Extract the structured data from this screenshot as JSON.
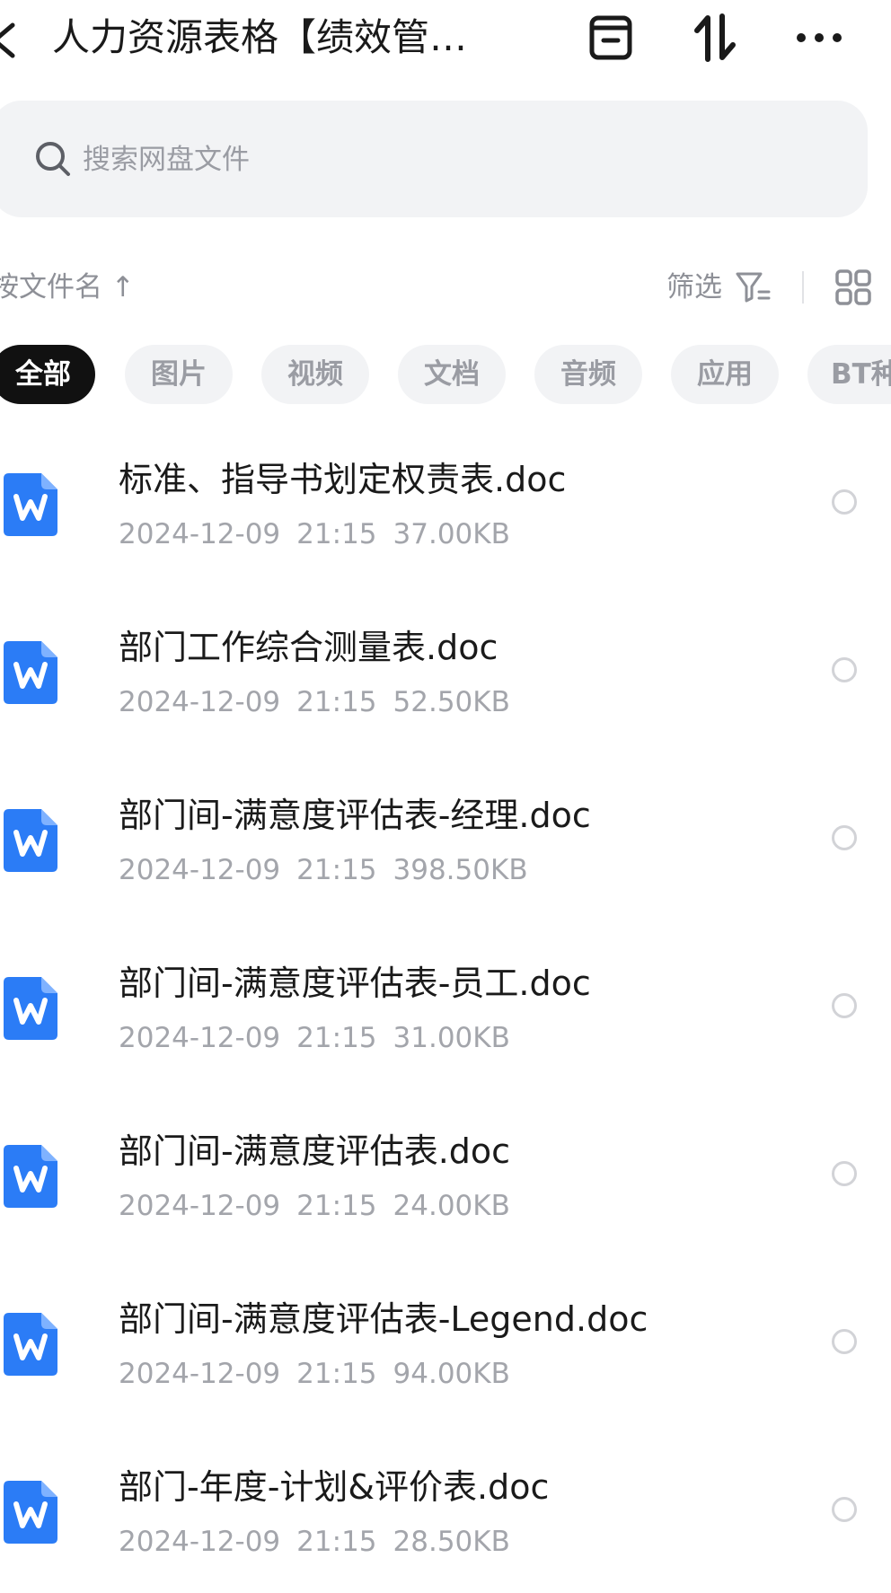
{
  "header": {
    "title": "人力资源表格【绩效管…"
  },
  "search": {
    "placeholder": "搜索网盘文件"
  },
  "sortbar": {
    "sort_label": "按文件名 ↑",
    "filter_label": "筛选"
  },
  "chips": [
    {
      "label": "全部",
      "active": true
    },
    {
      "label": "图片"
    },
    {
      "label": "视频"
    },
    {
      "label": "文档"
    },
    {
      "label": "音频"
    },
    {
      "label": "应用"
    },
    {
      "label": "BT种"
    }
  ],
  "files": [
    {
      "name": "标准、指导书划定权责表.doc",
      "date": "2024-12-09",
      "time": "21:15",
      "size": "37.00KB"
    },
    {
      "name": "部门工作综合测量表.doc",
      "date": "2024-12-09",
      "time": "21:15",
      "size": "52.50KB"
    },
    {
      "name": "部门间-满意度评估表-经理.doc",
      "date": "2024-12-09",
      "time": "21:15",
      "size": "398.50KB"
    },
    {
      "name": "部门间-满意度评估表-员工.doc",
      "date": "2024-12-09",
      "time": "21:15",
      "size": "31.00KB"
    },
    {
      "name": "部门间-满意度评估表.doc",
      "date": "2024-12-09",
      "time": "21:15",
      "size": "24.00KB"
    },
    {
      "name": "部门间-满意度评估表-Legend.doc",
      "date": "2024-12-09",
      "time": "21:15",
      "size": "94.00KB"
    },
    {
      "name": "部门-年度-计划&评价表.doc",
      "date": "2024-12-09",
      "time": "21:15",
      "size": "28.50KB"
    }
  ],
  "colors": {
    "word_icon": "#2b7cf6",
    "chip_active_bg": "#111111",
    "chip_bg": "#f2f3f5"
  },
  "icons": {
    "back": "chevron-left-icon",
    "archive": "archive-icon",
    "sort": "sort-arrows-icon",
    "more": "more-icon",
    "search": "search-icon",
    "filter": "filter-icon",
    "grid": "grid-view-icon",
    "file": "word-doc-icon"
  }
}
